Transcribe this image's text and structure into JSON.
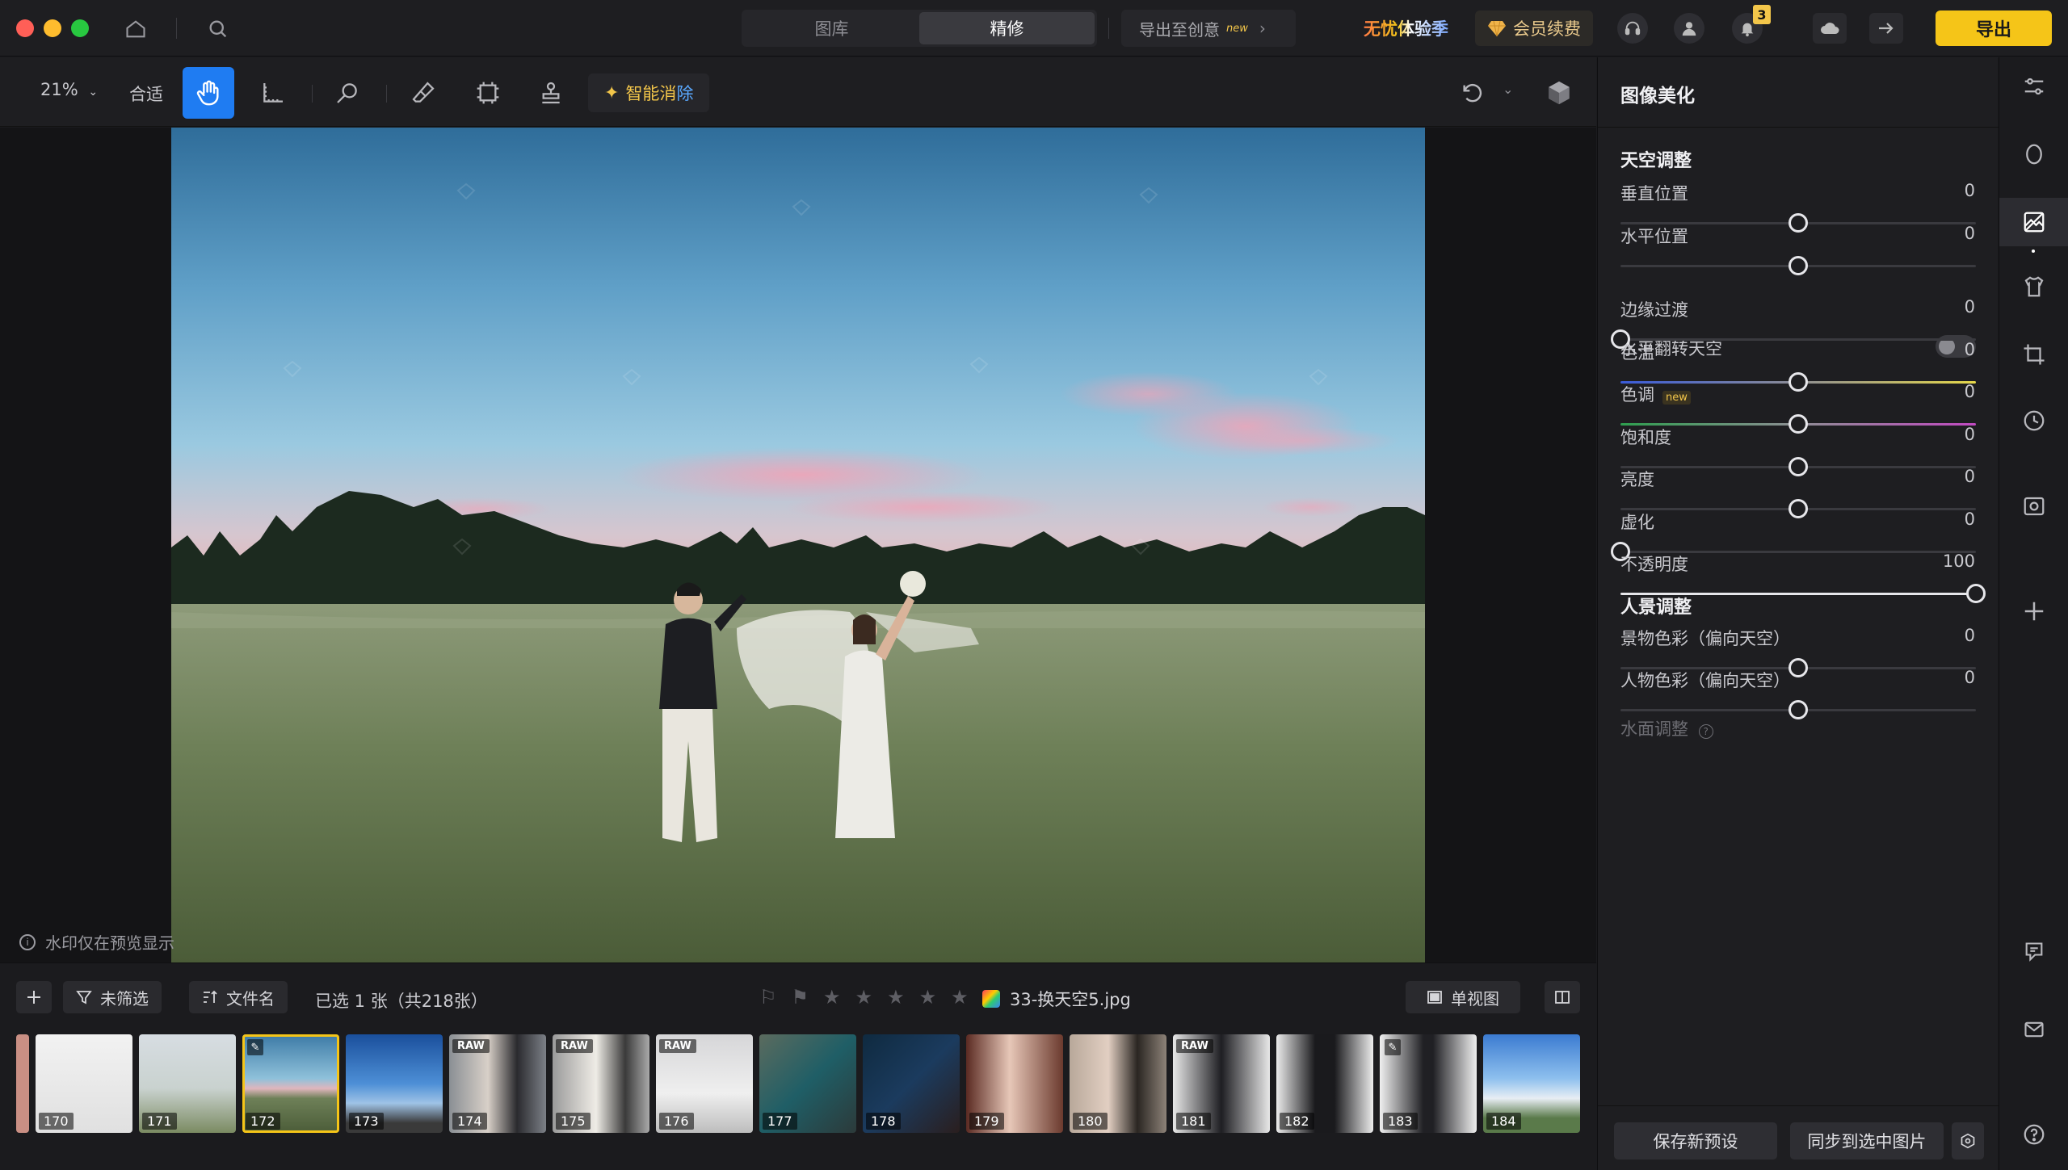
{
  "titlebar": {
    "tabs": [
      "图库",
      "精修"
    ],
    "active_tab": "精修",
    "export_create": "导出至创意",
    "new_tag": "new",
    "promo": "无忧体验季",
    "member": "会员续费",
    "notification_count": "3",
    "export": "导出"
  },
  "toolbar": {
    "zoom": "21%",
    "fit": "合适",
    "smart_a": "智能消",
    "smart_b": "除"
  },
  "canvas": {
    "watermark_note": "水印仅在预览显示"
  },
  "filmstrip": {
    "filter": "未筛选",
    "sort": "文件名",
    "selection": "已选 1 张（共218张）",
    "filename": "33-换天空5.jpg",
    "view_mode": "单视图",
    "thumbs": [
      {
        "num": "170",
        "badge": ""
      },
      {
        "num": "171",
        "badge": ""
      },
      {
        "num": "172",
        "badge": "pen"
      },
      {
        "num": "173",
        "badge": ""
      },
      {
        "num": "174",
        "badge": "RAW"
      },
      {
        "num": "175",
        "badge": "RAW"
      },
      {
        "num": "176",
        "badge": "RAW"
      },
      {
        "num": "177",
        "badge": ""
      },
      {
        "num": "178",
        "badge": ""
      },
      {
        "num": "179",
        "badge": ""
      },
      {
        "num": "180",
        "badge": ""
      },
      {
        "num": "181",
        "badge": "RAW"
      },
      {
        "num": "182",
        "badge": ""
      },
      {
        "num": "183",
        "badge": "pen"
      },
      {
        "num": "184",
        "badge": ""
      }
    ]
  },
  "panel": {
    "title": "图像美化",
    "sky_section": "天空调整",
    "sliders": [
      {
        "label": "垂直位置",
        "value": "0",
        "fraction": 0.5
      },
      {
        "label": "水平位置",
        "value": "0",
        "fraction": 0.5
      },
      {
        "label": "边缘过渡",
        "value": "0",
        "fraction": 0.0
      },
      {
        "label": "色温",
        "value": "0",
        "fraction": 0.5
      },
      {
        "label": "色调",
        "value": "0",
        "fraction": 0.5
      },
      {
        "label": "饱和度",
        "value": "0",
        "fraction": 0.5
      },
      {
        "label": "亮度",
        "value": "0",
        "fraction": 0.5
      },
      {
        "label": "虚化",
        "value": "0",
        "fraction": 0.0
      },
      {
        "label": "不透明度",
        "value": "100",
        "fraction": 1.0
      }
    ],
    "flip_label": "水平翻转天空",
    "tone_new": "new",
    "portrait_section": "人景调整",
    "portrait_sliders": [
      {
        "label": "景物色彩（偏向天空）",
        "value": "0",
        "fraction": 0.5
      },
      {
        "label": "人物色彩（偏向天空）",
        "value": "0",
        "fraction": 0.5
      }
    ],
    "water_label": "水面调整",
    "save_preset": "保存新预设",
    "sync": "同步到选中图片"
  },
  "colors": {
    "accent": "#1f7cf2",
    "export": "#f5c518",
    "selected_thumb": "#f5c518"
  }
}
